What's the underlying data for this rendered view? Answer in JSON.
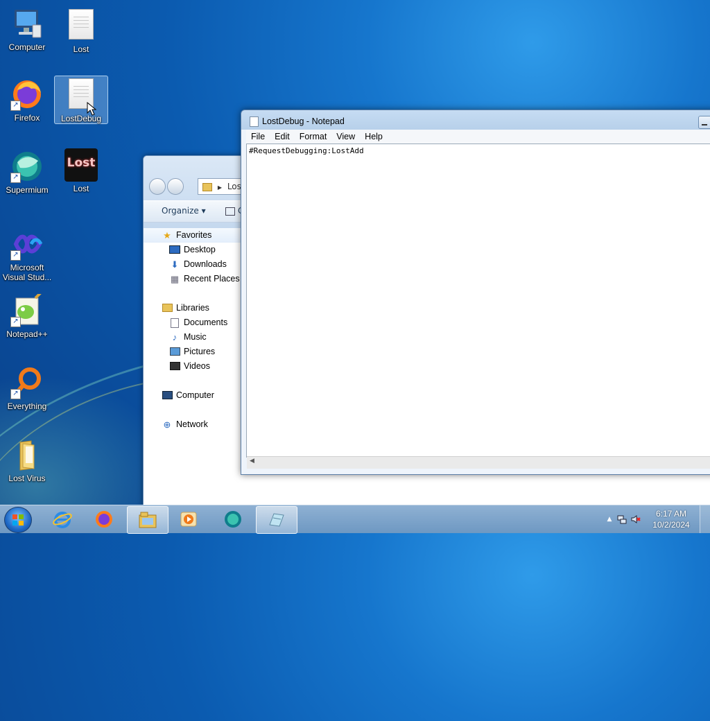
{
  "desktop": {
    "icons": [
      {
        "label": "Computer",
        "icon": "computer-icon"
      },
      {
        "label": "Lost",
        "icon": "text-file-icon"
      },
      {
        "label": "Firefox",
        "icon": "firefox-icon"
      },
      {
        "label": "LostDebug",
        "icon": "text-file-icon"
      },
      {
        "label": "Supermium",
        "icon": "supermium-icon"
      },
      {
        "label": "Lost",
        "icon": "lost-app-icon",
        "badge_text": "Lost"
      },
      {
        "label": "Microsoft Visual Stud...",
        "icon": "visual-studio-icon"
      },
      {
        "label": "Notepad++",
        "icon": "notepad-plus-plus-icon"
      },
      {
        "label": "Everything",
        "icon": "everything-search-icon"
      },
      {
        "label": "Lost Virus",
        "icon": "folder-icon"
      }
    ],
    "colors": {
      "wallpaper": "#0b5bb0",
      "selection": "#aad2fa"
    }
  },
  "explorer": {
    "address": "Lost",
    "toolbar": {
      "organize_label": "Organize ▾",
      "next_label": "C"
    },
    "nav": {
      "favorites": {
        "label": "Favorites",
        "items": [
          "Desktop",
          "Downloads",
          "Recent Places"
        ]
      },
      "libraries": {
        "label": "Libraries",
        "items": [
          "Documents",
          "Music",
          "Pictures",
          "Videos"
        ]
      },
      "computer": {
        "label": "Computer"
      },
      "network": {
        "label": "Network"
      }
    }
  },
  "notepad": {
    "title": "LostDebug - Notepad",
    "menu": [
      "File",
      "Edit",
      "Format",
      "View",
      "Help"
    ],
    "content": "#RequestDebugging:LostAdd"
  },
  "taskbar": {
    "pinned": [
      "internet-explorer-icon",
      "firefox-icon",
      "windows-explorer-icon",
      "media-player-icon",
      "supermium-icon",
      "notepad-icon"
    ],
    "active": [
      "windows-explorer-icon",
      "notepad-icon"
    ],
    "clock": {
      "time": "6:17 AM",
      "date": "10/2/2024"
    },
    "tray_icons": [
      "show-hidden-icons-arrow",
      "network-icon",
      "volume-muted-icon"
    ]
  }
}
